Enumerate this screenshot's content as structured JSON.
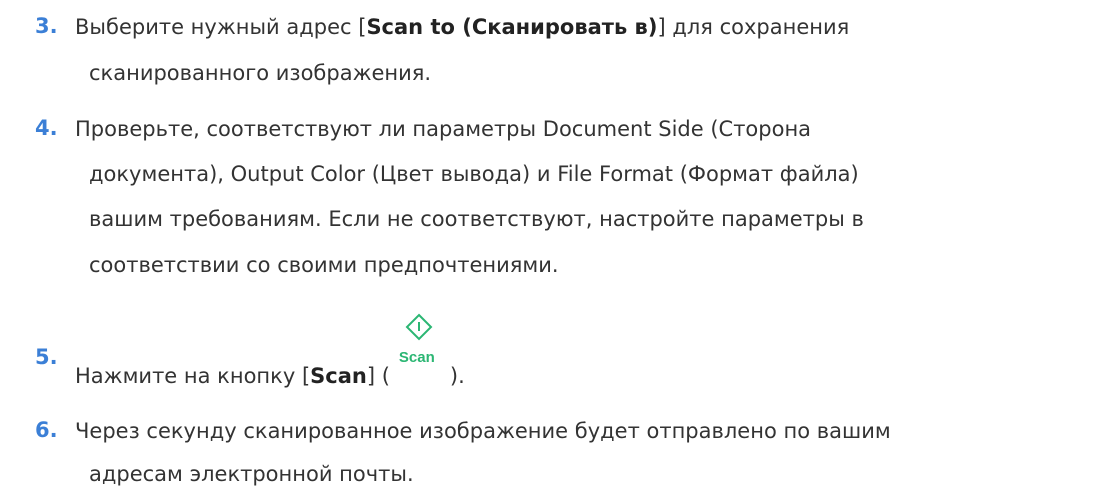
{
  "steps": [
    {
      "number": "3.",
      "line1_pre": "Выберите нужный адрес [",
      "line1_bold": "Scan to (Сканировать в)",
      "line1_post": "] для сохранения",
      "line2": "сканированного изображения."
    },
    {
      "number": "4.",
      "line1": "Проверьте, соответствуют ли параметры Document Side (Сторона",
      "line2": "документа), Output Color (Цвет вывода) и File Format (Формат файла)",
      "line3": "вашим требованиям. Если не соответствуют, настройте параметры в",
      "line4": "соответствии со своими предпочтениями."
    },
    {
      "number": "5.",
      "pre": "Нажмите на кнопку [",
      "bold": "Scan",
      "mid": "] (",
      "icon_label": "Scan",
      "post": ")."
    },
    {
      "number": "6.",
      "line1": "Через секунду сканированное изображение будет отправлено по вашим",
      "line2": "адресам электронной почты."
    }
  ],
  "colors": {
    "step_number": "#3b7fd6",
    "scan_icon": "#2bb673",
    "text": "#333333"
  },
  "icons": {
    "scan": "scan-diamond-icon"
  }
}
